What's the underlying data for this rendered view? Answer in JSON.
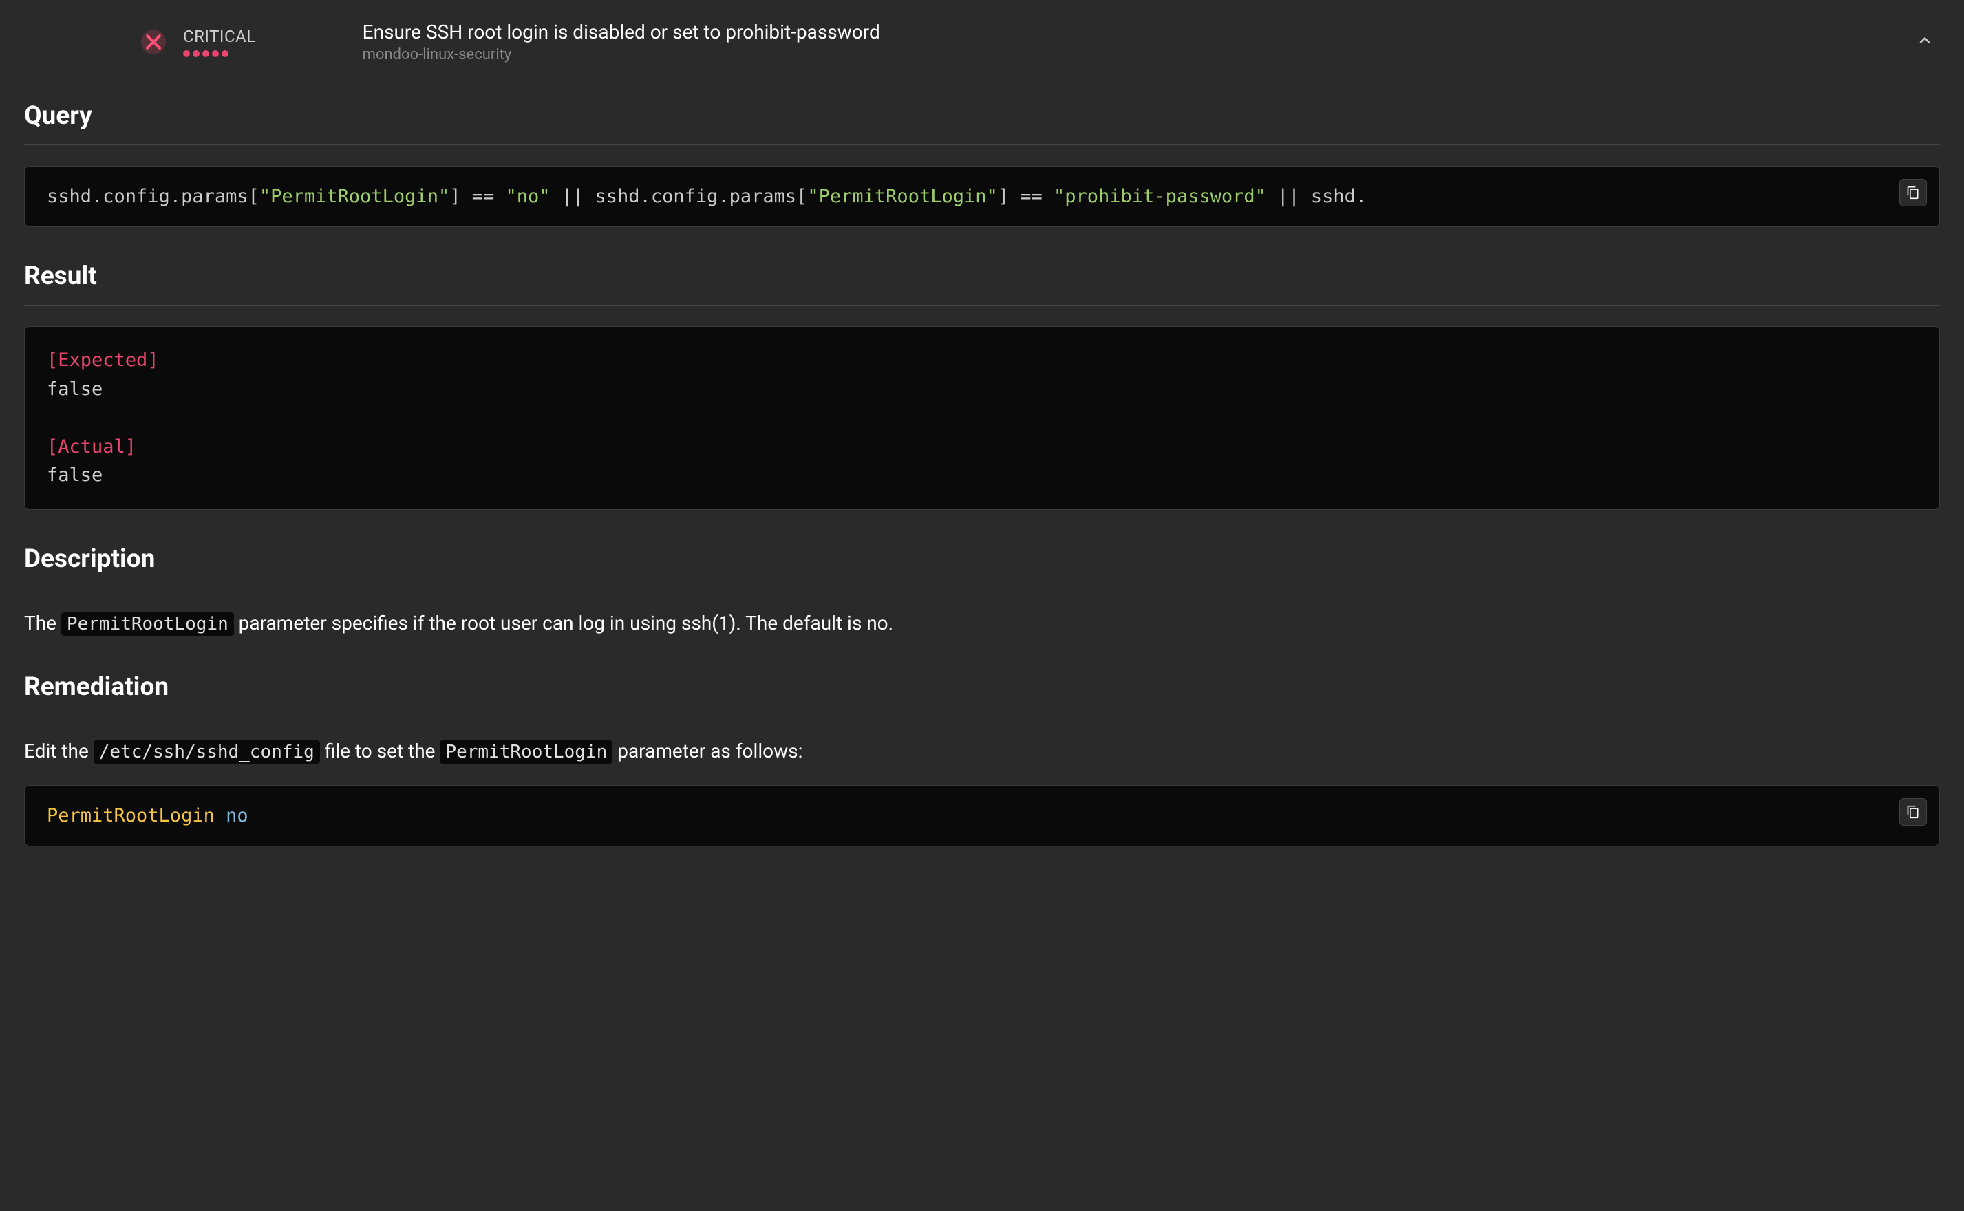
{
  "header": {
    "severity_label": "CRITICAL",
    "severity_level": 5,
    "title": "Ensure SSH root login is disabled or set to prohibit-password",
    "subtitle": "mondoo-linux-security"
  },
  "sections": {
    "query": {
      "heading": "Query",
      "code": "sshd.config.params[\"PermitRootLogin\"] == \"no\" || sshd.config.params[\"PermitRootLogin\"] == \"prohibit-password\" || sshd."
    },
    "result": {
      "heading": "Result",
      "expected_label": "[Expected]",
      "expected_value": "false",
      "actual_label": "[Actual]",
      "actual_value": "false"
    },
    "description": {
      "heading": "Description",
      "text_before": "The ",
      "code_param": "PermitRootLogin",
      "text_after": " parameter specifies if the root user can log in using ssh(1). The default is no."
    },
    "remediation": {
      "heading": "Remediation",
      "text_1": "Edit the ",
      "code_path": "/etc/ssh/sshd_config",
      "text_2": " file to set the ",
      "code_param": "PermitRootLogin",
      "text_3": " parameter as follows:",
      "code_key": "PermitRootLogin",
      "code_value": "no"
    }
  }
}
